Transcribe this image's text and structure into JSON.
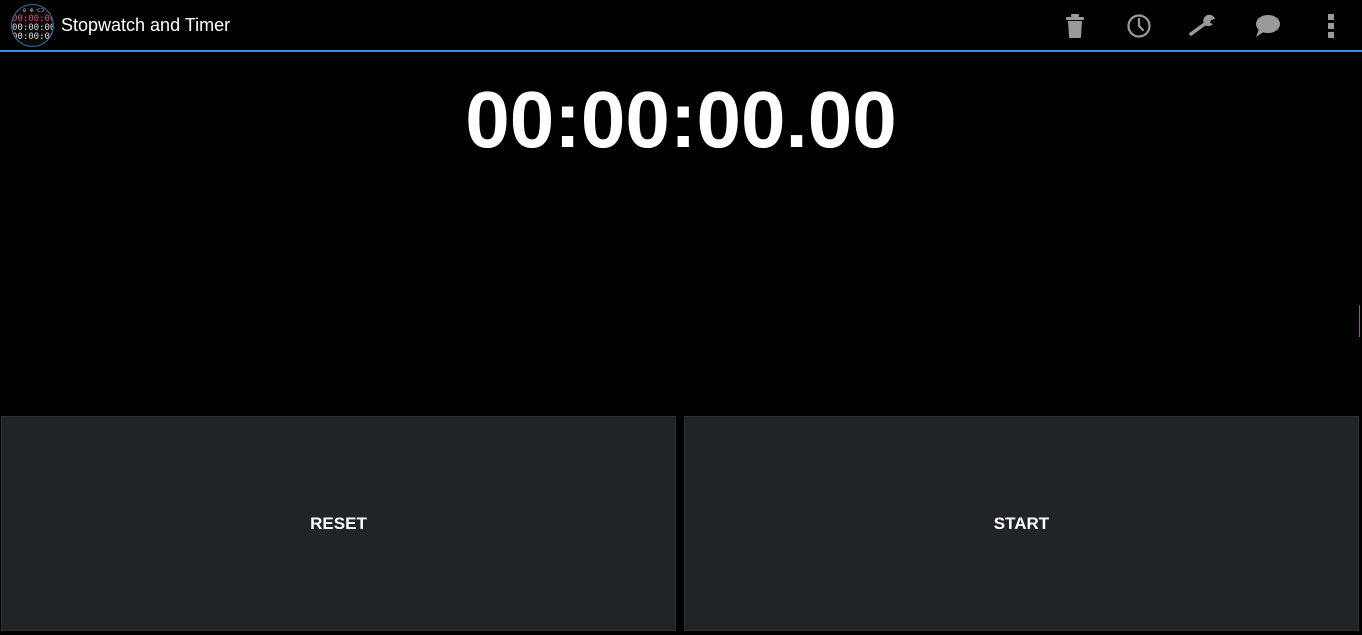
{
  "app": {
    "title": "Stopwatch and Timer",
    "icon": {
      "name": "stopwatch-app-icon",
      "line0": "⊖ ⊕ ⊂⊃",
      "line1": "00:00:00",
      "line2": "00:00:00",
      "line3": "00:00:00",
      "accent_color": "#e0457b"
    }
  },
  "action_bar": {
    "divider_color": "#3b8ed4",
    "actions": [
      {
        "name": "trash-icon"
      },
      {
        "name": "history-icon"
      },
      {
        "name": "wrench-icon"
      },
      {
        "name": "chat-bubble-icon"
      },
      {
        "name": "overflow-menu-icon"
      }
    ]
  },
  "stopwatch": {
    "time": "00:00:00.00"
  },
  "buttons": {
    "reset_label": "RESET",
    "start_label": "START",
    "background": "#212427"
  }
}
